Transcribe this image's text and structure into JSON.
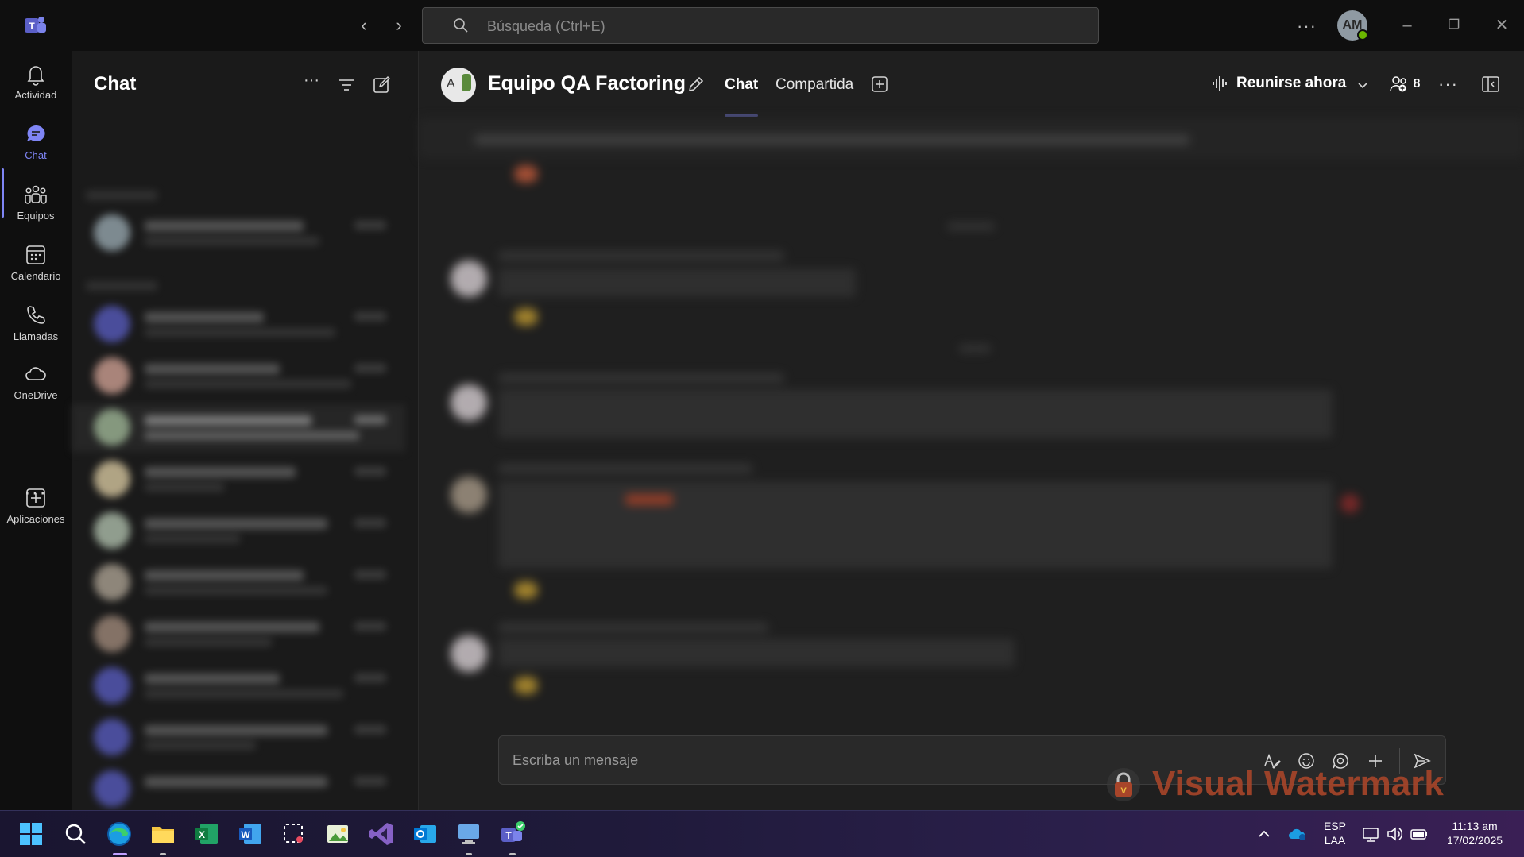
{
  "titlebar": {
    "search_placeholder": "Búsqueda (Ctrl+E)",
    "user_initials": "AM",
    "more_label": "···"
  },
  "rail": {
    "items": [
      {
        "label": "Actividad",
        "icon": "bell-icon"
      },
      {
        "label": "Chat",
        "icon": "chat-icon",
        "active": true
      },
      {
        "label": "Equipos",
        "icon": "teams-icon"
      },
      {
        "label": "Calendario",
        "icon": "calendar-icon"
      },
      {
        "label": "Llamadas",
        "icon": "phone-icon"
      },
      {
        "label": "OneDrive",
        "icon": "cloud-icon"
      }
    ],
    "more_label": "···",
    "apps_label": "Aplicaciones"
  },
  "chatlist": {
    "title": "Chat",
    "more_label": "···"
  },
  "channel": {
    "avatar_letter": "A",
    "title": "Equipo QA Factoring",
    "tabs": [
      {
        "label": "Chat",
        "active": true
      },
      {
        "label": "Compartida",
        "active": false
      }
    ],
    "meet_label": "Reunirse ahora",
    "participants_count": "8",
    "more_label": "···"
  },
  "composer": {
    "placeholder": "Escriba un mensaje"
  },
  "watermark": {
    "text": "Visual Watermark"
  },
  "taskbar": {
    "language": "ESP",
    "layout": "LAA",
    "time": "11:13 am",
    "date": "17/02/2025"
  },
  "colors": {
    "accent": "#7f85f5",
    "titlebar_bg": "#0f0f0f",
    "main_bg": "#1f1f1f",
    "presence_available": "#6bb700",
    "watermark": "#a8452a"
  }
}
